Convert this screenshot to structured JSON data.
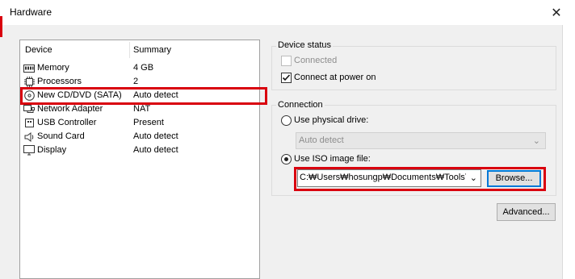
{
  "window": {
    "title": "Hardware"
  },
  "device_list": {
    "headers": {
      "device": "Device",
      "summary": "Summary"
    },
    "rows": [
      {
        "name": "Memory",
        "summary": "4 GB",
        "icon": "memory-icon"
      },
      {
        "name": "Processors",
        "summary": "2",
        "icon": "processor-icon"
      },
      {
        "name": "New CD/DVD (SATA)",
        "summary": "Auto detect",
        "icon": "cd-dvd-icon"
      },
      {
        "name": "Network Adapter",
        "summary": "NAT",
        "icon": "network-adapter-icon"
      },
      {
        "name": "USB Controller",
        "summary": "Present",
        "icon": "usb-icon"
      },
      {
        "name": "Sound Card",
        "summary": "Auto detect",
        "icon": "sound-icon"
      },
      {
        "name": "Display",
        "summary": "Auto detect",
        "icon": "display-icon"
      }
    ]
  },
  "device_status": {
    "title": "Device status",
    "connected": "Connected",
    "connect_at_power_on": "Connect at power on"
  },
  "connection": {
    "title": "Connection",
    "use_physical_drive": "Use physical drive:",
    "physical_drive_value": "Auto detect",
    "use_iso_image": "Use ISO image file:",
    "iso_path": "C:₩Users₩hosungp₩Documents₩ToolsT",
    "browse": "Browse..."
  },
  "advanced_button": "Advanced...",
  "colors": {
    "highlight": "#d9000e",
    "focus": "#0078d7"
  }
}
